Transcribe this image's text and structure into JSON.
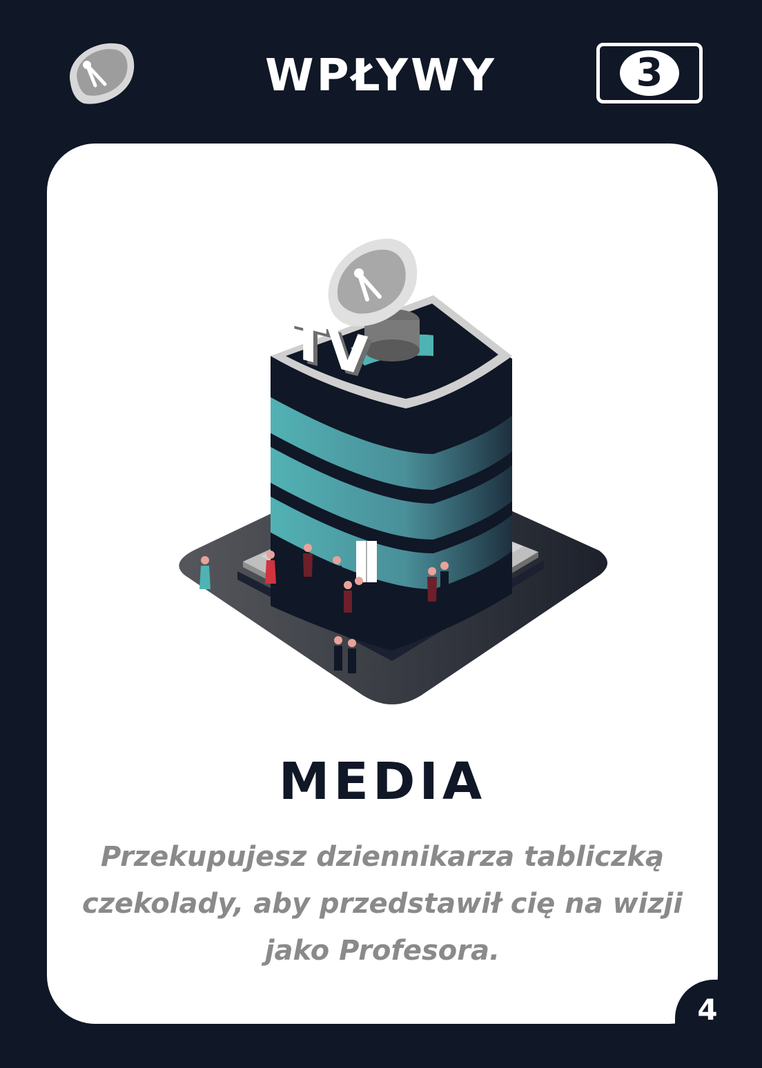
{
  "header": {
    "category": "WPŁYWY",
    "cost": "3",
    "category_icon": "satellite-dish-icon"
  },
  "card": {
    "name": "MEDIA",
    "description": "Przekupujesz dziennikarza tabliczką czekolady, aby przedstawił cię na wizji jako Profesora.",
    "sign_text": "TV",
    "page": "4"
  },
  "colors": {
    "background": "#101726",
    "card": "#ffffff",
    "teal": "#4fb3b4",
    "description": "#8a8a8a"
  }
}
